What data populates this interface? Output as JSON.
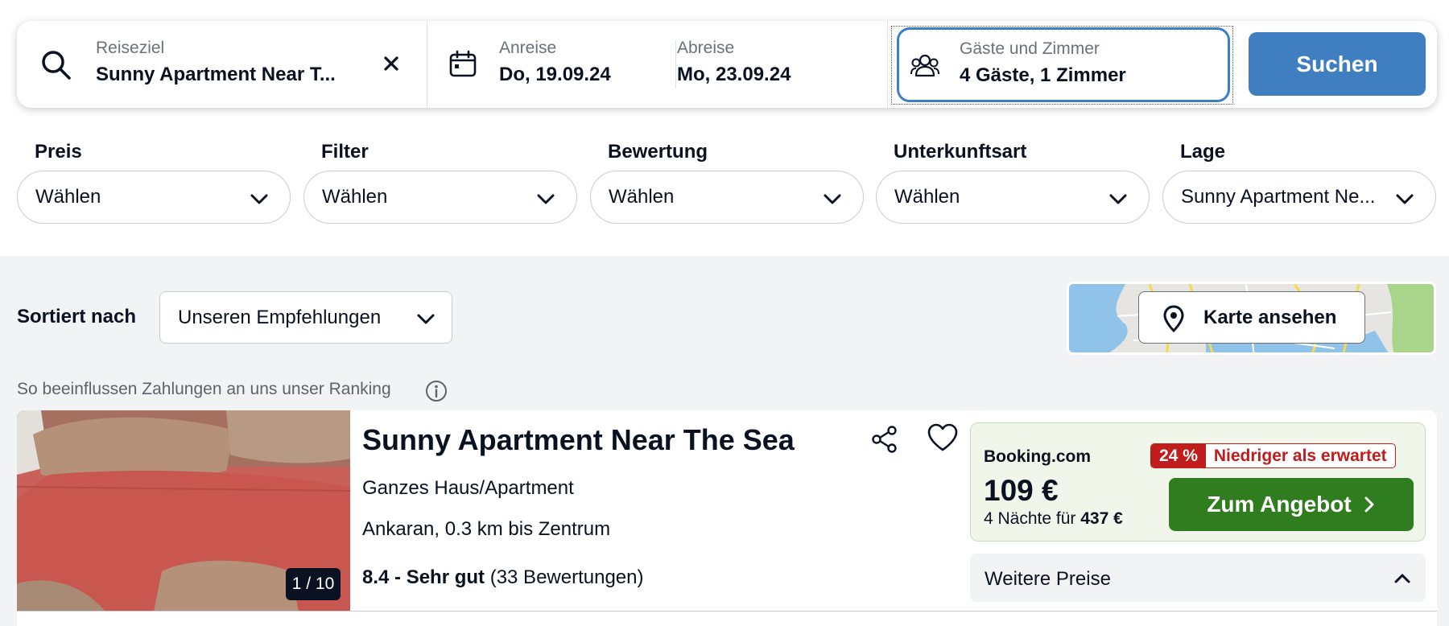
{
  "search": {
    "destination": {
      "label": "Reiseziel",
      "value": "Sunny Apartment Near T..."
    },
    "checkin": {
      "label": "Anreise",
      "value": "Do, 19.09.24"
    },
    "checkout": {
      "label": "Abreise",
      "value": "Mo, 23.09.24"
    },
    "guests": {
      "label": "Gäste und Zimmer",
      "value": "4 Gäste, 1 Zimmer"
    },
    "button_label": "Suchen"
  },
  "filters": [
    {
      "title": "Preis",
      "value": "Wählen"
    },
    {
      "title": "Filter",
      "value": "Wählen"
    },
    {
      "title": "Bewertung",
      "value": "Wählen"
    },
    {
      "title": "Unterkunftsart",
      "value": "Wählen"
    },
    {
      "title": "Lage",
      "value": "Sunny Apartment Ne..."
    }
  ],
  "sort": {
    "label": "Sortiert nach",
    "value": "Unseren Empfehlungen"
  },
  "map": {
    "button_label": "Karte ansehen"
  },
  "ranking_note": "So beeinflussen Zahlungen an uns unser Ranking",
  "result": {
    "name": "Sunny Apartment Near The Sea",
    "type": "Ganzes Haus/Apartment",
    "location": "Ankaran, 0.3 km bis Zentrum",
    "rating_score": "8.4 - Sehr gut",
    "rating_count": "(33 Bewertungen)",
    "photo_counter": "1 / 10",
    "deal": {
      "provider": "Booking.com",
      "discount_pct": "24 %",
      "discount_text": "Niedriger als erwartet",
      "price": "109 €",
      "nights_text": "4 Nächte für",
      "total": "437 €",
      "button_label": "Zum Angebot"
    },
    "more_prices_label": "Weitere Preise"
  },
  "colors": {
    "primary_blue": "#3f7fc1",
    "offer_green": "#2f7d1f",
    "discount_red": "#c21b1b",
    "deal_bg": "#f0f7ea"
  },
  "icons": [
    "search-icon",
    "clear-icon",
    "calendar-icon",
    "guests-icon",
    "chevron-down-icon",
    "map-pin-icon",
    "info-icon",
    "share-icon",
    "heart-icon",
    "chevron-right-icon",
    "chevron-up-icon"
  ]
}
